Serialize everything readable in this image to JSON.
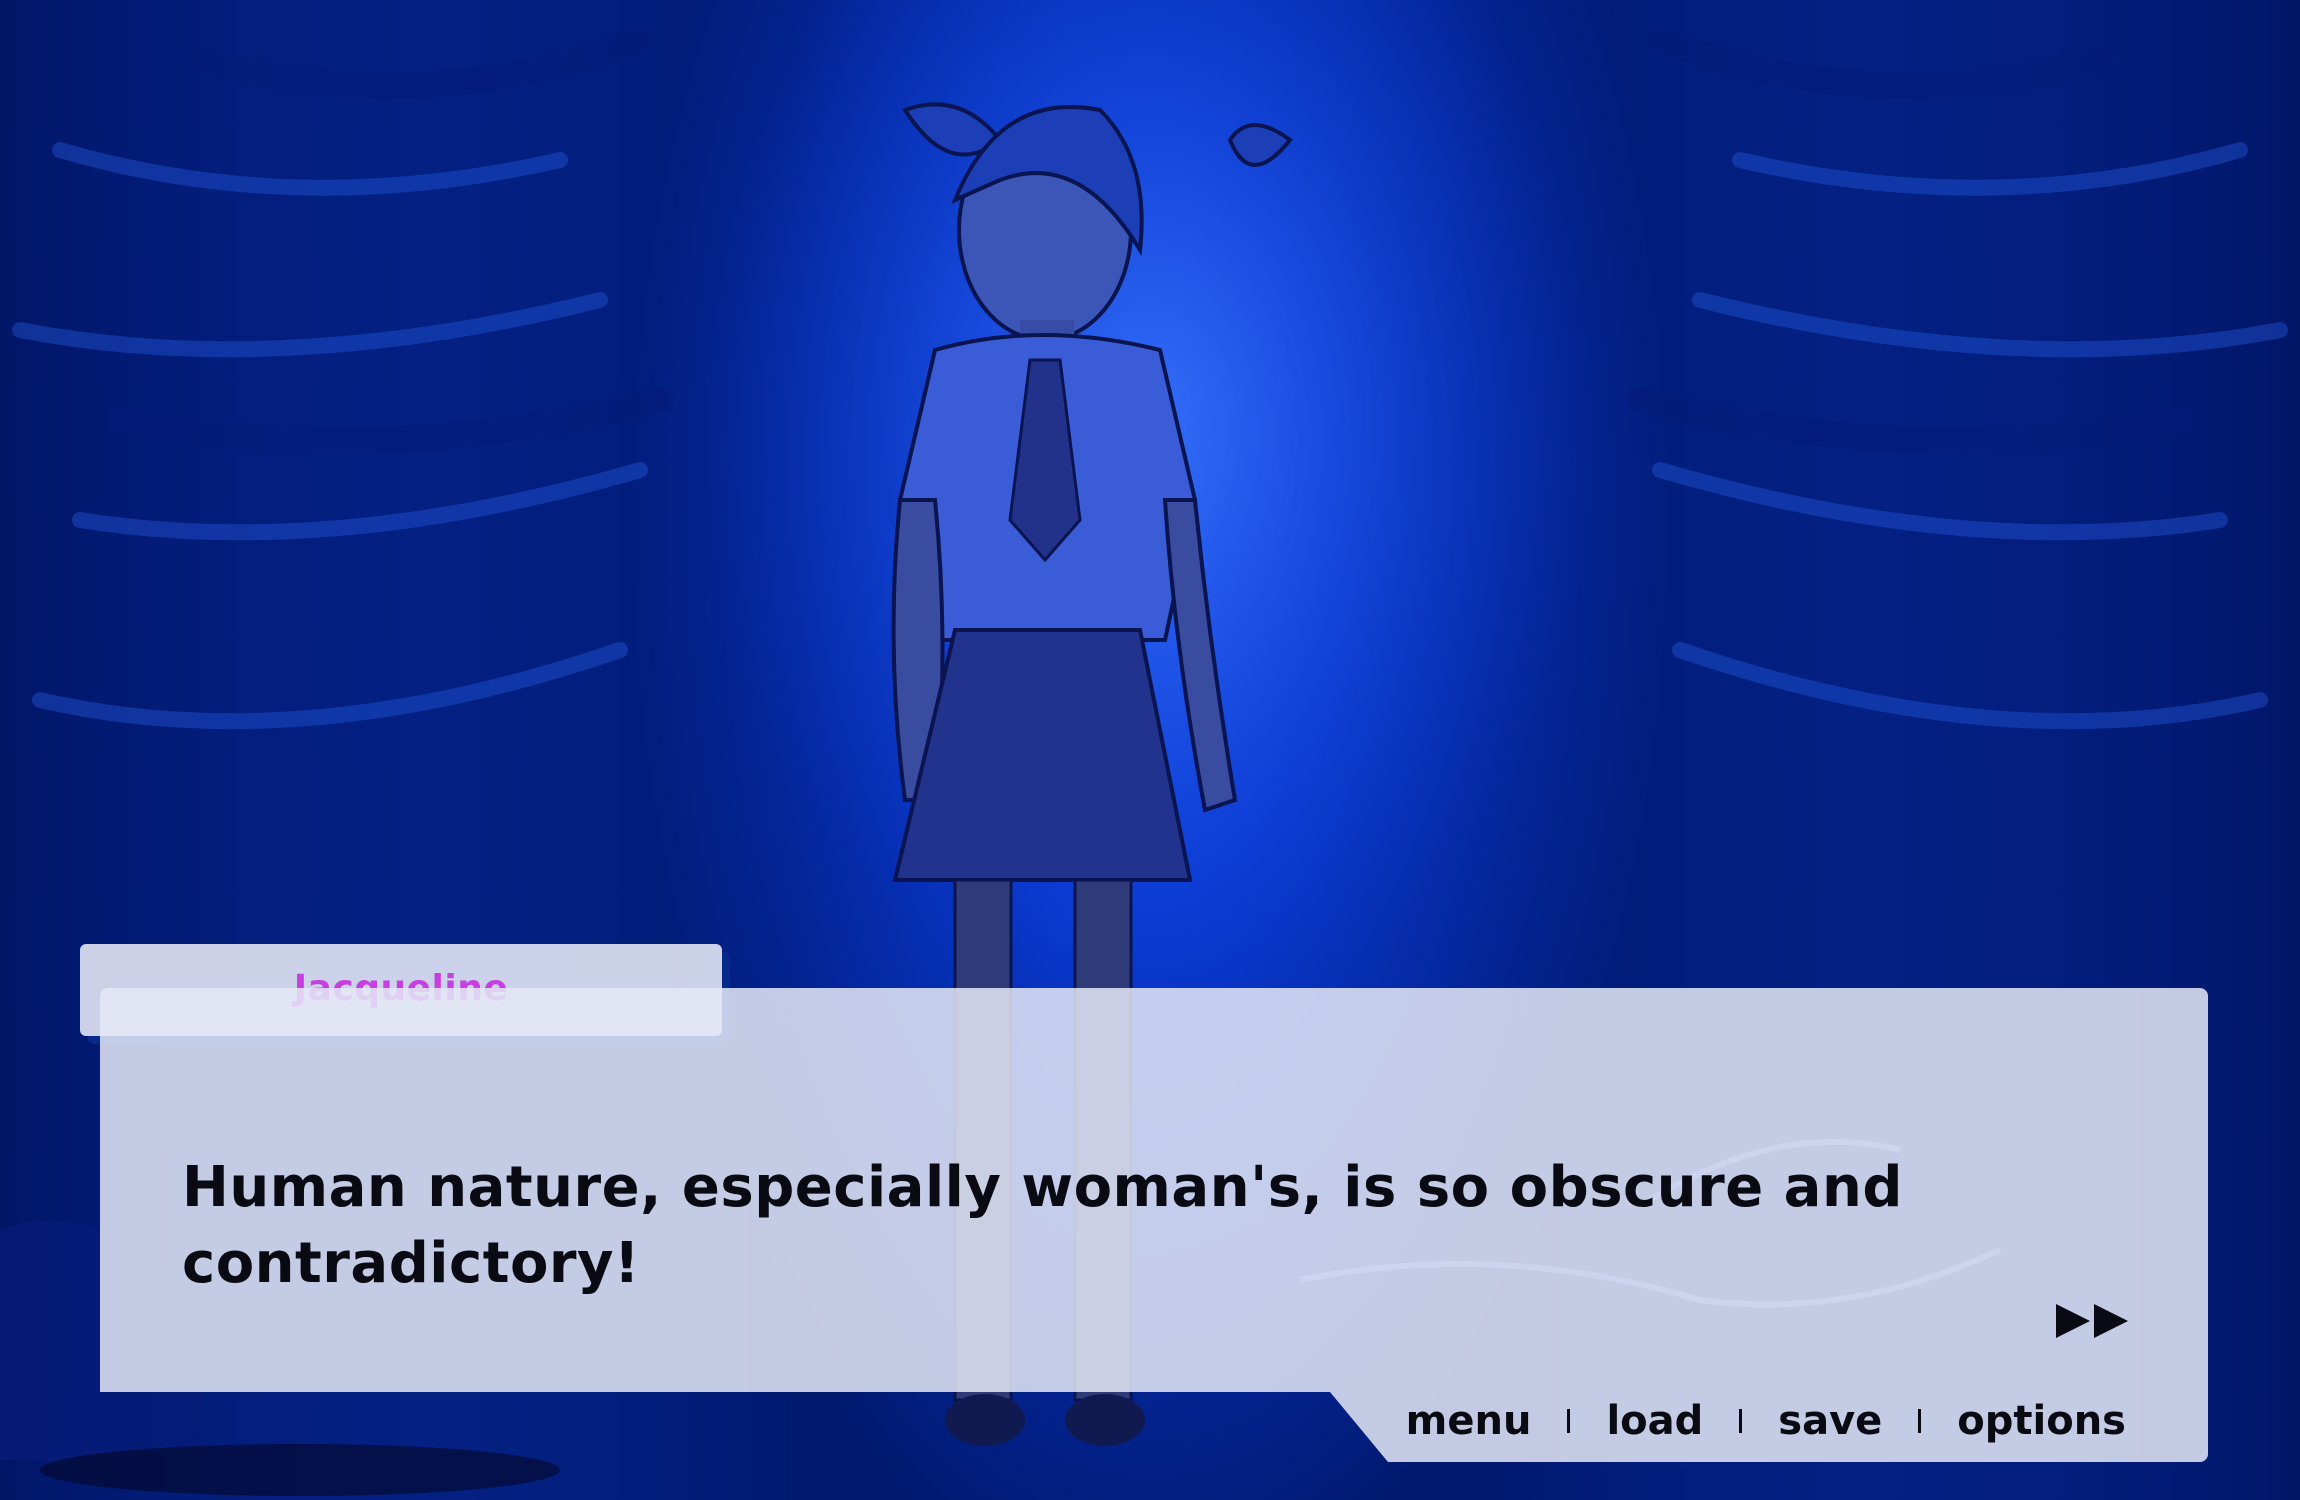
{
  "dialogue": {
    "speaker": "Jacqueline",
    "text": "Human nature, especially woman's, is so obscure and contradictory!",
    "speaker_color": "#c63fe0"
  },
  "quick_menu": {
    "items": [
      "menu",
      "load",
      "save",
      "options"
    ]
  },
  "icons": {
    "skip": "fast-forward-icon"
  },
  "colors": {
    "scene_tint": "#0a3ad2",
    "box_bg": "#e4e8f6",
    "text": "#0a0a12"
  }
}
